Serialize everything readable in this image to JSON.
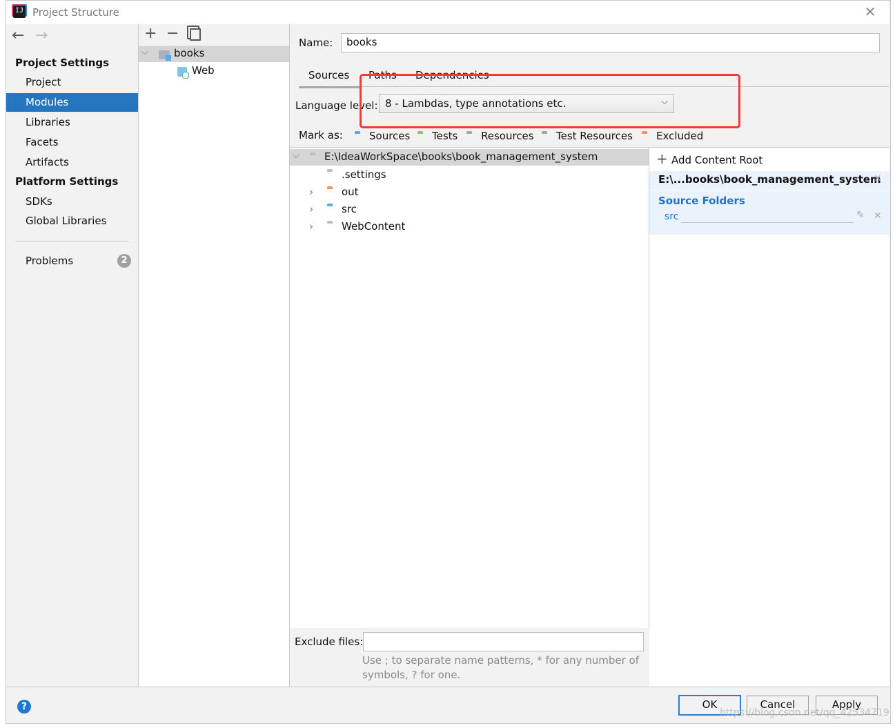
{
  "window": {
    "title": "Project Structure",
    "close_icon": "close-icon"
  },
  "sidebar": {
    "project_settings_header": "Project Settings",
    "project_items": [
      "Project",
      "Modules",
      "Libraries",
      "Facets",
      "Artifacts"
    ],
    "platform_settings_header": "Platform Settings",
    "platform_items": [
      "SDKs",
      "Global Libraries"
    ],
    "problems_label": "Problems",
    "problems_count": "2",
    "selected_item": "Modules"
  },
  "module_tree": {
    "root": "books",
    "child": "Web"
  },
  "main": {
    "name_label": "Name:",
    "name_value": "books",
    "tabs": [
      "Sources",
      "Paths",
      "Dependencies"
    ],
    "active_tab": "Sources",
    "language_level_label": "Language level:",
    "language_level_value": "8 - Lambdas, type annotations etc.",
    "mark_as_label": "Mark as:",
    "mark_as_options": [
      {
        "label": "Sources",
        "color": "#5aa8e0"
      },
      {
        "label": "Tests",
        "color": "#8cc36e"
      },
      {
        "label": "Resources",
        "color": "#9aa7b5"
      },
      {
        "label": "Test Resources",
        "color": "#9aa7b5"
      },
      {
        "label": "Excluded",
        "color": "#ef9563"
      }
    ]
  },
  "content_tree": {
    "root": "E:\\IdeaWorkSpace\\books\\book_management_system",
    "children": [
      {
        "name": ".settings",
        "color": "#b8bfc6",
        "expandable": false
      },
      {
        "name": "out",
        "color": "#ef9563",
        "expandable": true
      },
      {
        "name": "src",
        "color": "#5aa8e0",
        "expandable": true
      },
      {
        "name": "WebContent",
        "color": "#b8bfc6",
        "expandable": true
      }
    ]
  },
  "content_root_panel": {
    "add_label": "Add Content Root",
    "root_path": "E:\\...books\\book_management_system",
    "source_folders_header": "Source Folders",
    "source_folder": "src"
  },
  "exclude": {
    "label": "Exclude files:",
    "value": "",
    "hint_line1": "Use ; to separate name patterns, * for any number of",
    "hint_line2": "symbols, ? for one."
  },
  "footer": {
    "ok": "OK",
    "cancel": "Cancel",
    "apply": "Apply",
    "watermark": "https://blog.csdn.net/qq_42534719"
  },
  "colors": {
    "selection": "#2675bf",
    "highlight_red": "#f03a3a",
    "panel_bg": "#f2f2f2",
    "tree_selected": "#d5d5d5",
    "source_panel_bg": "#eaf3fc"
  }
}
